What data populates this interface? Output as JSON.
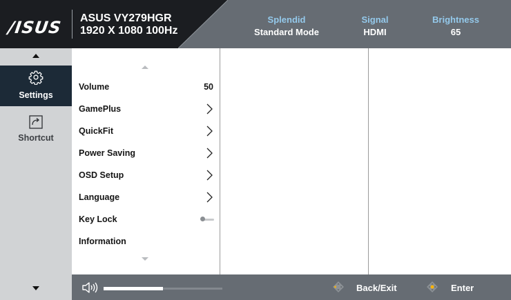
{
  "header": {
    "logo": "/ISUS",
    "model_name": "ASUS VY279HGR",
    "model_spec": "1920 X 1080 100Hz",
    "status": [
      {
        "label": "Splendid",
        "value": "Standard Mode"
      },
      {
        "label": "Signal",
        "value": "HDMI"
      },
      {
        "label": "Brightness",
        "value": "65"
      }
    ]
  },
  "nav": {
    "items": [
      {
        "label": "Settings",
        "icon": "gear-icon",
        "selected": true
      },
      {
        "label": "Shortcut",
        "icon": "shortcut-icon",
        "selected": false
      }
    ]
  },
  "menu": {
    "items": [
      {
        "label": "Volume",
        "value": "50"
      },
      {
        "label": "GamePlus",
        "control": "chevron-right-icon"
      },
      {
        "label": "QuickFit",
        "control": "chevron-right-icon"
      },
      {
        "label": "Power Saving",
        "control": "chevron-right-icon"
      },
      {
        "label": "OSD Setup",
        "control": "chevron-right-icon"
      },
      {
        "label": "Language",
        "control": "chevron-right-icon"
      },
      {
        "label": "Key Lock",
        "control": "toggle-off",
        "enabled": false
      },
      {
        "label": "Information"
      }
    ]
  },
  "footer": {
    "volume_icon": "speaker-icon",
    "volume_level": 0.5,
    "back_label": "Back/Exit",
    "enter_label": "Enter"
  },
  "colors": {
    "header_dark": "#1b1d21",
    "header_gray": "#666c73",
    "accent_label": "#94c9eb",
    "nav_bg": "#d1d3d5",
    "nav_selected": "#1c2a37"
  }
}
